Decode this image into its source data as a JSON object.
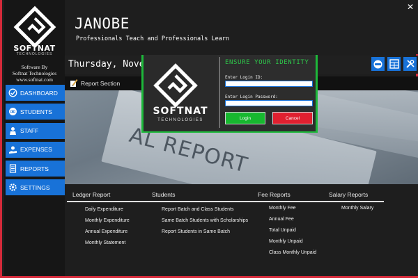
{
  "window": {
    "close_label": "✕"
  },
  "brand": {
    "name": "SOFTNAT",
    "tagline": "TECHNOLOGIES",
    "credits_line1": "Software By",
    "credits_line2": "Softnat Technologies",
    "credits_line3": "www.softnat.com"
  },
  "sidebar": {
    "items": [
      {
        "label": "DASHBOARD",
        "icon": "dashboard-icon"
      },
      {
        "label": "STUDENTS",
        "icon": "students-icon"
      },
      {
        "label": "STAFF",
        "icon": "staff-icon"
      },
      {
        "label": "EXPENSES",
        "icon": "expenses-icon"
      },
      {
        "label": "REPORTS",
        "icon": "reports-icon",
        "active": true
      },
      {
        "label": "SETTINGS",
        "icon": "gear-icon"
      }
    ]
  },
  "header": {
    "title": "JANOBE",
    "subtitle": "Professionals Teach and Professionals Learn"
  },
  "datebar": {
    "date": "Thursday, Novemb",
    "icons": [
      "headset-icon",
      "calculator-icon",
      "tools-icon"
    ]
  },
  "section": {
    "title": "Report Section"
  },
  "banner": {
    "text": "AL REPORT"
  },
  "reports": {
    "categories": [
      {
        "heading": "Ledger Report",
        "links": [
          "Daily Expenditure",
          "Monthly Expenditure",
          "Annual Expenditure",
          "Monthly Statement"
        ]
      },
      {
        "heading": "Students",
        "links": [
          "Report Batch and Class Students",
          "Same Batch Students with Scholarships",
          "Report Students in Same Batch"
        ]
      },
      {
        "heading": "Fee Reports",
        "links": [
          "Monthly Fee",
          "Annual Fee",
          "Total Unpaid",
          "Monthly Unpaid",
          "Class Monthly Unpaid"
        ]
      },
      {
        "heading": "Salary Reports",
        "links": [
          "Monthly Salary"
        ]
      }
    ]
  },
  "login": {
    "title": "ENSURE YOUR IDENTITY",
    "id_label": "Enter Login ID:",
    "id_value": "",
    "password_label": "Enter Login Password:",
    "password_value": "",
    "login_button": "Login",
    "cancel_button": "Cancel",
    "brand_name": "SOFTNAT",
    "brand_tagline": "TECHNOLOGIES"
  },
  "colors": {
    "accent_blue": "#1872d8",
    "frame_red": "#d42a3a",
    "login_green": "#17b82f",
    "cancel_red": "#e02030",
    "title_green": "#2ec64a"
  }
}
